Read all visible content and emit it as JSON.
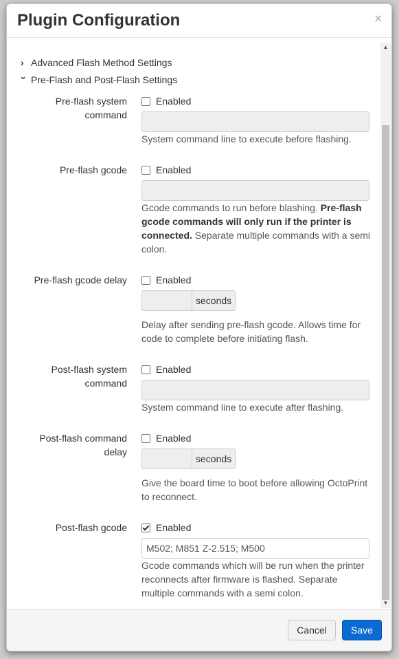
{
  "modal": {
    "title": "Plugin Configuration",
    "close": "×"
  },
  "sections": {
    "advanced": "Advanced Flash Method Settings",
    "prepost": "Pre-Flash and Post-Flash Settings"
  },
  "settings": {
    "preflash_cmd": {
      "label_line1": "Pre-flash system",
      "label_line2": "command",
      "checkbox": "Enabled",
      "checked": false,
      "value": "",
      "help": "System command line to execute before flashing."
    },
    "preflash_gcode": {
      "label": "Pre-flash gcode",
      "checkbox": "Enabled",
      "checked": false,
      "value": "",
      "help_part1": "Gcode commands to run before blashing. ",
      "help_bold": "Pre-flash gcode commands will only run if the printer is connected.",
      "help_part2": " Separate multiple commands with a semi colon."
    },
    "preflash_delay": {
      "label": "Pre-flash gcode delay",
      "checkbox": "Enabled",
      "checked": false,
      "unit": "seconds",
      "help": "Delay after sending pre-flash gcode. Allows time for code to complete before initiating flash."
    },
    "postflash_cmd": {
      "label_line1": "Post-flash system",
      "label_line2": "command",
      "checkbox": "Enabled",
      "checked": false,
      "value": "",
      "help": "System command line to execute after flashing."
    },
    "postflash_delay": {
      "label_line1": "Post-flash command",
      "label_line2": "delay",
      "checkbox": "Enabled",
      "checked": false,
      "unit": "seconds",
      "help": "Give the board time to boot before allowing OctoPrint to reconnect."
    },
    "postflash_gcode": {
      "label": "Post-flash gcode",
      "checkbox": "Enabled",
      "checked": true,
      "value": "M502; M851 Z-2.515; M500",
      "help": "Gcode commands which will be run when the printer reconnects after firmware is flashed. Separate multiple commands with a semi colon."
    }
  },
  "footer": {
    "cancel": "Cancel",
    "save": "Save"
  },
  "colors": {
    "save_button": "#0b6bd3",
    "overlay": "#8c8c8c"
  },
  "icons": [
    "close-icon",
    "chevron-right-icon",
    "chevron-down-icon",
    "checkbox-icon",
    "scroll-up-arrow-icon",
    "scroll-down-arrow-icon"
  ]
}
